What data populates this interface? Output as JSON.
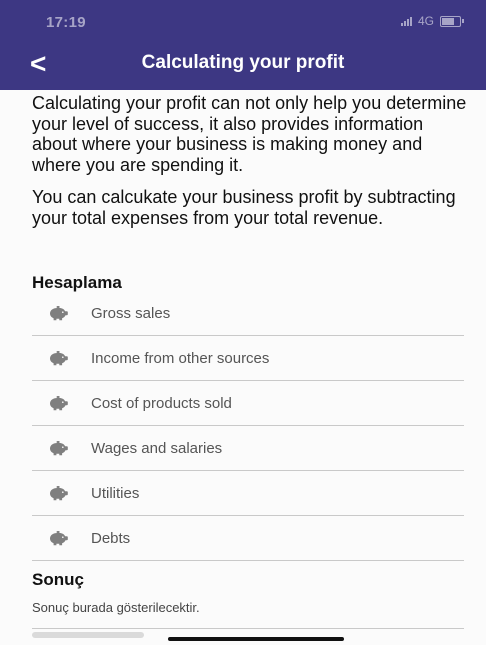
{
  "status_bar": {
    "time": "17:19",
    "network": "4G"
  },
  "header": {
    "back_label": "<",
    "title": "Calculating your profit"
  },
  "content": {
    "paragraphs": [
      "Calculating your profit can not only help you determine your level of success, it also provides information about where your business is making money and where you are spending it.",
      "You can calcukate your business profit by subtracting your total expenses from your total revenue."
    ],
    "calc_title": "Hesaplama",
    "items": [
      {
        "label": "Gross sales",
        "icon": "piggy-bank-icon"
      },
      {
        "label": "Income from other sources",
        "icon": "piggy-bank-icon"
      },
      {
        "label": "Cost of products sold",
        "icon": "piggy-bank-icon"
      },
      {
        "label": "Wages and salaries",
        "icon": "piggy-bank-icon"
      },
      {
        "label": "Utilities",
        "icon": "piggy-bank-icon"
      },
      {
        "label": "Debts",
        "icon": "piggy-bank-icon"
      }
    ],
    "result_title": "Sonuç",
    "result_text": "Sonuç burada gösterilecektir."
  },
  "colors": {
    "header_bg": "#3d3783",
    "icon_gray": "#7f7f7f"
  }
}
